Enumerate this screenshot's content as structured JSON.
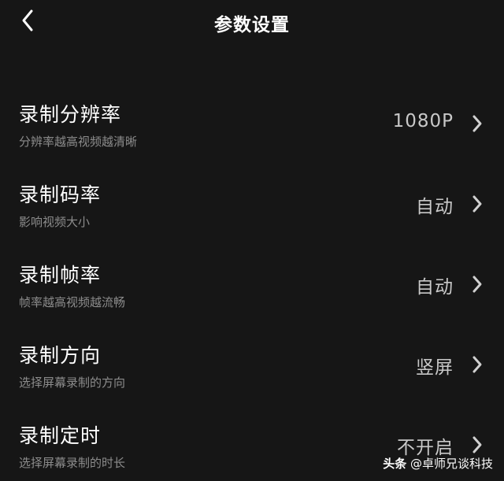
{
  "header": {
    "title": "参数设置",
    "back_icon": "chevron-left-icon"
  },
  "settings": [
    {
      "id": "resolution",
      "title": "录制分辨率",
      "description": "分辨率越高视频越清晰",
      "value": "1080P"
    },
    {
      "id": "bitrate",
      "title": "录制码率",
      "description": "影响视频大小",
      "value": "自动"
    },
    {
      "id": "framerate",
      "title": "录制帧率",
      "description": "帧率越高视频越流畅",
      "value": "自动"
    },
    {
      "id": "orientation",
      "title": "录制方向",
      "description": "选择屏幕录制的方向",
      "value": "竖屏"
    },
    {
      "id": "timer",
      "title": "录制定时",
      "description": "选择屏幕录制的时长",
      "value": "不开启"
    }
  ],
  "watermark": {
    "brand": "头条",
    "handle": "@卓师兄谈科技"
  },
  "colors": {
    "background": "#161616",
    "title_text": "#ffffff",
    "description_text": "#8c8c8c",
    "value_text": "#c8c8c8"
  }
}
